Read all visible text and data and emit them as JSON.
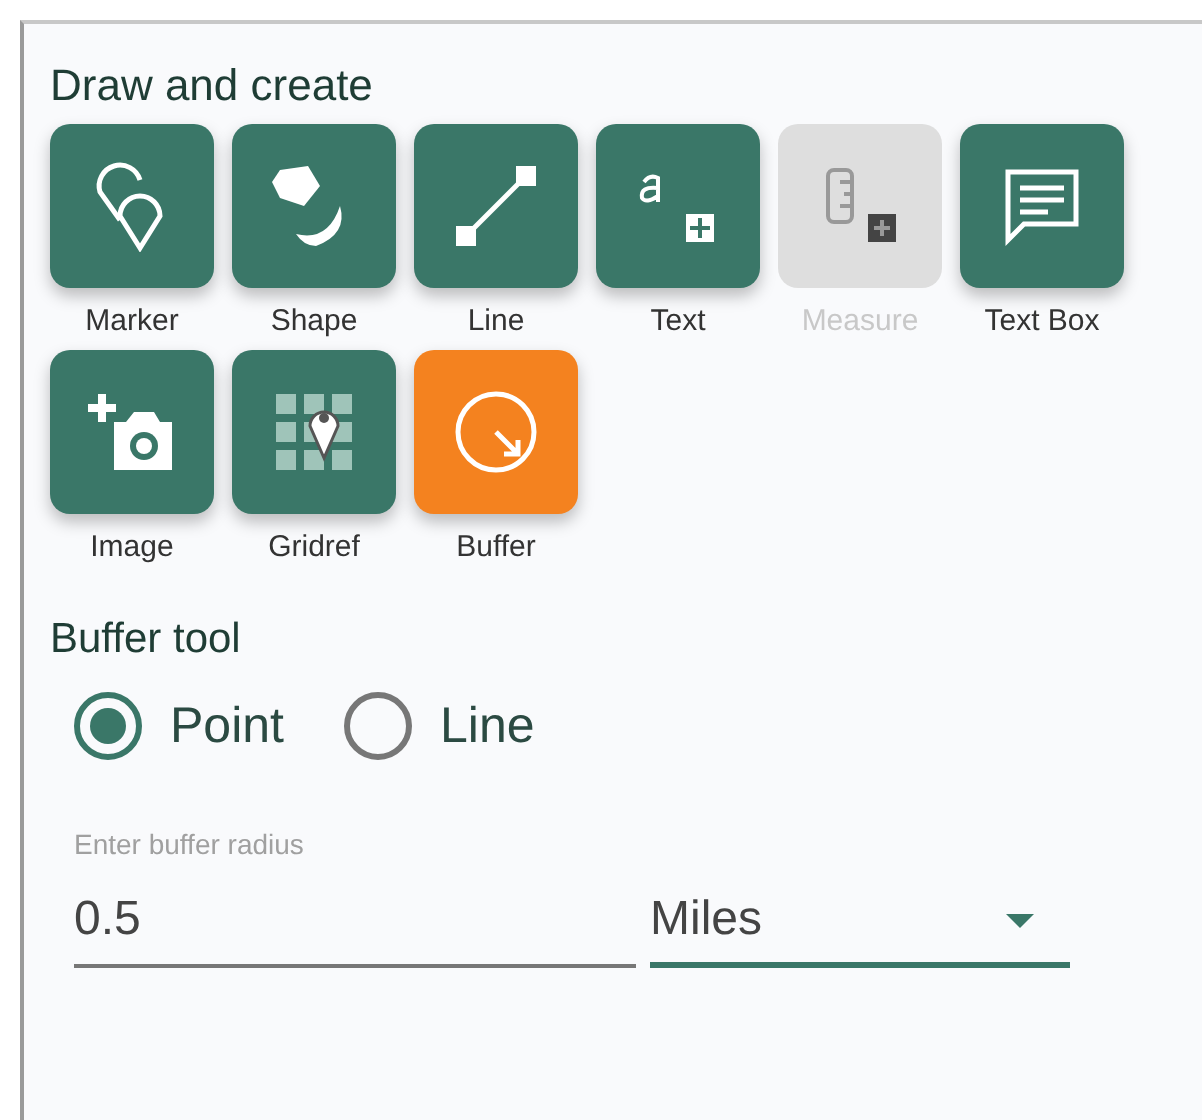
{
  "title": "Draw and create",
  "tools": [
    {
      "kind": "marker",
      "label": "Marker",
      "selected": false,
      "disabled": false
    },
    {
      "kind": "shape",
      "label": "Shape",
      "selected": false,
      "disabled": false
    },
    {
      "kind": "line",
      "label": "Line",
      "selected": false,
      "disabled": false
    },
    {
      "kind": "text",
      "label": "Text",
      "selected": false,
      "disabled": false
    },
    {
      "kind": "measure",
      "label": "Measure",
      "selected": false,
      "disabled": true
    },
    {
      "kind": "textbox",
      "label": "Text Box",
      "selected": false,
      "disabled": false
    },
    {
      "kind": "image",
      "label": "Image",
      "selected": false,
      "disabled": false
    },
    {
      "kind": "gridref",
      "label": "Gridref",
      "selected": false,
      "disabled": false
    },
    {
      "kind": "buffer",
      "label": "Buffer",
      "selected": true,
      "disabled": false
    }
  ],
  "buffer_tool": {
    "title": "Buffer tool",
    "modes": [
      {
        "label": "Point",
        "selected": true
      },
      {
        "label": "Line",
        "selected": false
      }
    ],
    "radius": {
      "label": "Enter buffer radius",
      "value": "0.5"
    },
    "unit": {
      "value": "Miles"
    }
  }
}
